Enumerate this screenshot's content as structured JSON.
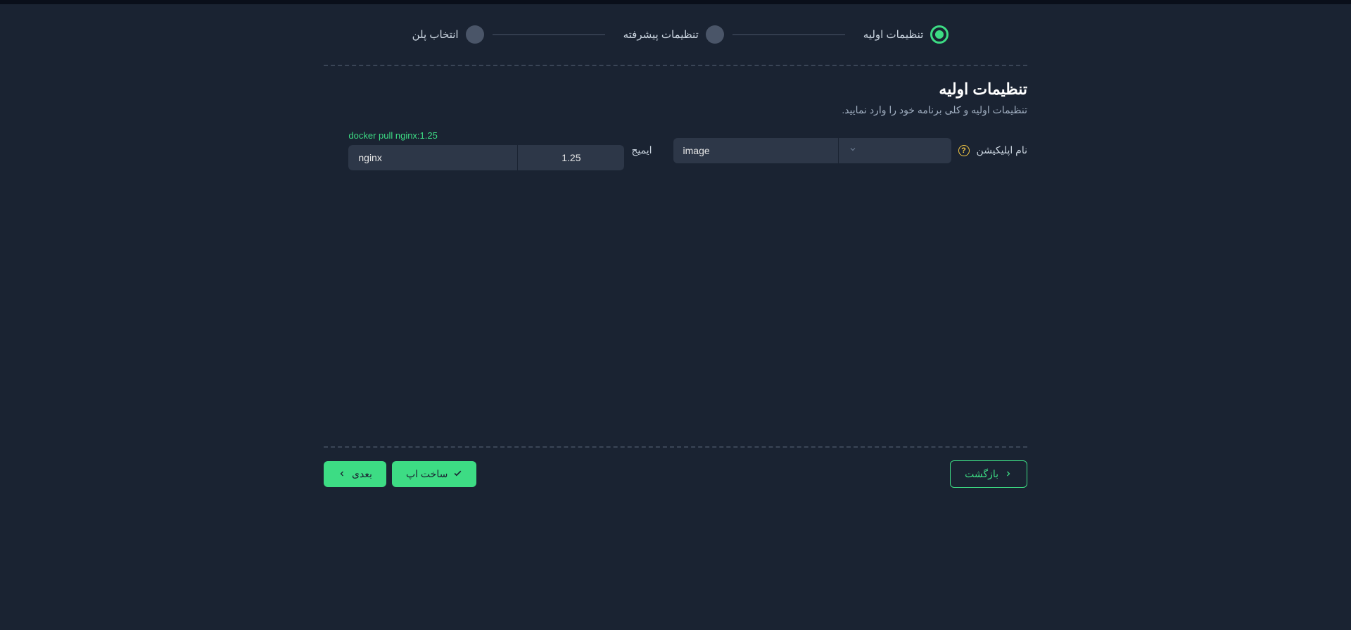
{
  "stepper": {
    "steps": [
      {
        "label": "تنظیمات اولیه",
        "active": true
      },
      {
        "label": "تنظیمات پیشرفته",
        "active": false
      },
      {
        "label": "انتخاب پلن",
        "active": false
      }
    ]
  },
  "section": {
    "title": "تنظیمات اولیه",
    "subtitle": "تنظیمات اولیه و کلی برنامه خود را وارد نمایید."
  },
  "form": {
    "appNameLabel": "نام اپلیکیشن",
    "appNameValue": "image",
    "imageLabel": "ایمیج",
    "imageName": "nginx",
    "imageTag": "1.25",
    "dockerHint": "docker pull nginx:1.25"
  },
  "footer": {
    "backLabel": "بازگشت",
    "createLabel": "ساخت اپ",
    "nextLabel": "بعدی"
  }
}
